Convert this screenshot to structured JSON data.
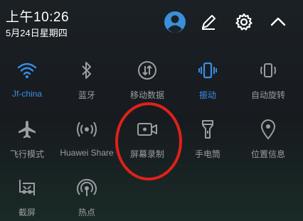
{
  "status": {
    "time": "上午10:26",
    "date": "5月24日星期四"
  },
  "header_icons": [
    "avatar",
    "edit-pencil-icon",
    "settings-gear-icon",
    "collapse-chevron-icon"
  ],
  "colors": {
    "active": "#3a8ee6",
    "inactive": "#9a9ea1",
    "highlight": "#e0201b",
    "background": "#161a1e"
  },
  "tiles": [
    {
      "label": "Jf-china",
      "icon": "wifi-icon",
      "active": true
    },
    {
      "label": "蓝牙",
      "icon": "bluetooth-icon",
      "active": false
    },
    {
      "label": "移动数据",
      "icon": "mobile-data-icon",
      "active": false
    },
    {
      "label": "振动",
      "icon": "vibrate-icon",
      "active": true
    },
    {
      "label": "自动旋转",
      "icon": "auto-rotate-icon",
      "active": false
    },
    {
      "label": "飞行模式",
      "icon": "airplane-icon",
      "active": false
    },
    {
      "label": "Huawei Share",
      "icon": "huawei-share-icon",
      "active": false
    },
    {
      "label": "屏幕录制",
      "icon": "screen-record-icon",
      "active": false
    },
    {
      "label": "手电筒",
      "icon": "flashlight-icon",
      "active": false
    },
    {
      "label": "位置信息",
      "icon": "location-icon",
      "active": false
    },
    {
      "label": "截屏",
      "icon": "screenshot-icon",
      "active": false
    },
    {
      "label": "热点",
      "icon": "hotspot-icon",
      "active": false
    }
  ]
}
